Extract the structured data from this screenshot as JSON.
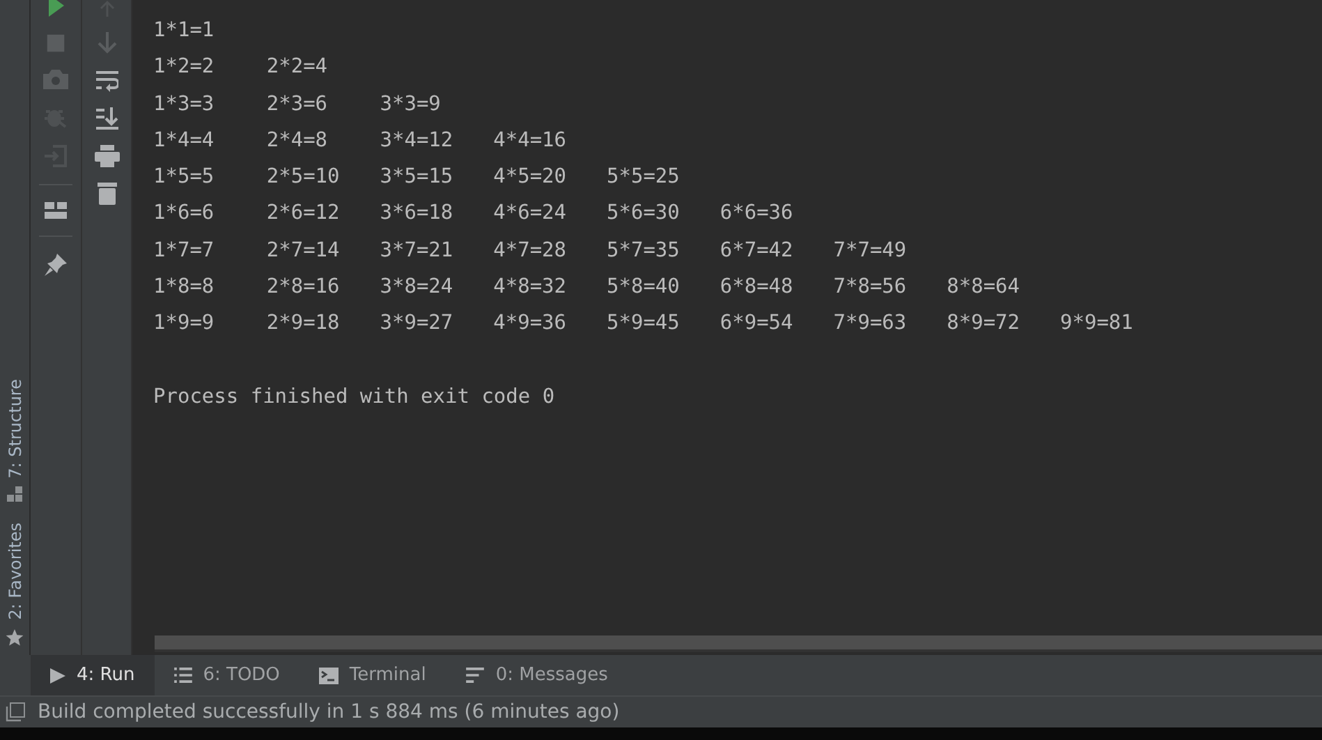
{
  "side_tabs": [
    {
      "label": "7: Structure",
      "kind": "structure"
    },
    {
      "label": "2: Favorites",
      "kind": "favorites"
    }
  ],
  "console": {
    "lines": [
      "1*1=1\t",
      "1*2=2\t2*2=4\t",
      "1*3=3\t2*3=6\t3*3=9\t",
      "1*4=4\t2*4=8\t3*4=12\t4*4=16\t",
      "1*5=5\t2*5=10\t3*5=15\t4*5=20\t5*5=25\t",
      "1*6=6\t2*6=12\t3*6=18\t4*6=24\t5*6=30\t6*6=36\t",
      "1*7=7\t2*7=14\t3*7=21\t4*7=28\t5*7=35\t6*7=42\t7*7=49\t",
      "1*8=8\t2*8=16\t3*8=24\t4*8=32\t5*8=40\t6*8=48\t7*8=56\t8*8=64\t",
      "1*9=9\t2*9=18\t3*9=27\t4*9=36\t5*9=45\t6*9=54\t7*9=63\t8*9=72\t9*9=81\t"
    ],
    "exit_message": "Process finished with exit code 0"
  },
  "tool_tabs": [
    {
      "label": "4: Run",
      "kind": "run",
      "selected": true
    },
    {
      "label": "6: TODO",
      "kind": "todo",
      "selected": false
    },
    {
      "label": "Terminal",
      "kind": "terminal",
      "selected": false
    },
    {
      "label": "0: Messages",
      "kind": "messages",
      "selected": false
    }
  ],
  "status_bar": "Build completed successfully in 1 s 884 ms (6 minutes ago)"
}
